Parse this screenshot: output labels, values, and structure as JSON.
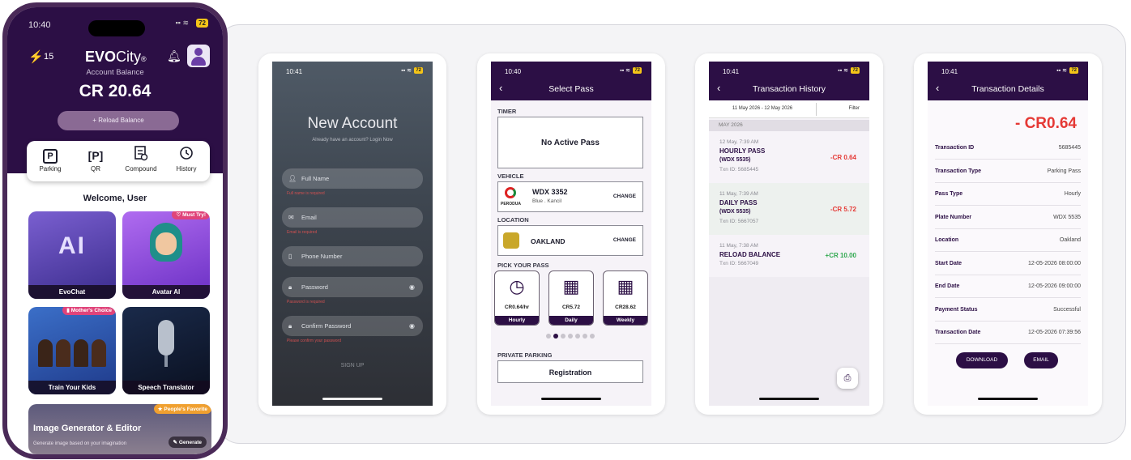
{
  "colors": {
    "brand": "#2c0f45",
    "negative": "#e53935",
    "positive": "#2fa84f",
    "battery": "#f5c518"
  },
  "home": {
    "time": "10:40",
    "battery": "72",
    "bolt_count": "15",
    "logo_bold": "EVO",
    "logo_rest": "City",
    "logo_mark": "®",
    "account_label": "Account Balance",
    "balance": "CR 20.64",
    "reload_label": "+ Reload Balance",
    "quick": [
      {
        "label": "Parking",
        "icon": "P"
      },
      {
        "label": "QR",
        "icon": "[P]"
      },
      {
        "label": "Compound",
        "icon": "compound-icon"
      },
      {
        "label": "History",
        "icon": "history-icon"
      }
    ],
    "welcome": "Welcome, User",
    "cards": [
      {
        "label": "EvoChat",
        "art": "AI"
      },
      {
        "label": "Avatar AI",
        "tag": "Must Try!"
      },
      {
        "label": "Train Your Kids",
        "tag": "Mother's Choice"
      },
      {
        "label": "Speech Translator"
      }
    ],
    "image_card": {
      "title": "Image Generator & Editor",
      "subtitle": "Generate image based on your imagination",
      "tag": "People's Favorite",
      "button": "Generate"
    }
  },
  "new_account": {
    "time": "10:41",
    "battery": "72",
    "title": "New Account",
    "subtitle": "Already have an account? Login Now",
    "fields": [
      {
        "placeholder": "Full Name",
        "error": "Full name is required"
      },
      {
        "placeholder": "Email",
        "error": "Email is required"
      },
      {
        "placeholder": "Phone Number",
        "error": ""
      },
      {
        "placeholder": "Password",
        "error": "Password is required"
      },
      {
        "placeholder": "Confirm Password",
        "error": "Please confirm your password"
      }
    ],
    "signup": "SIGN UP"
  },
  "select_pass": {
    "time": "10:40",
    "battery": "72",
    "title": "Select Pass",
    "timer_label": "TIMER",
    "no_active": "No Active Pass",
    "vehicle_label": "VEHICLE",
    "plate": "WDX 3352",
    "model": "Blue . Kancil",
    "brand": "PERODUA",
    "change": "CHANGE",
    "location_label": "LOCATION",
    "location": "OAKLAND",
    "pick_label": "PICK YOUR PASS",
    "passes": [
      {
        "price": "CR0.64/hr",
        "name": "Hourly"
      },
      {
        "price": "CR5.72",
        "name": "Daily"
      },
      {
        "price": "CR28.62",
        "name": "Weekly"
      }
    ],
    "pager_count": "7",
    "pager_active": "2",
    "private_label": "PRIVATE PARKING",
    "registration": "Registration"
  },
  "history": {
    "time": "10:41",
    "battery": "72",
    "title": "Transaction History",
    "date_range": "11 May 2026 - 12 May 2026",
    "filter": "Filter",
    "month": "MAY 2026",
    "items": [
      {
        "date": "12 May, 7:39 AM",
        "name": "HOURLY PASS",
        "plate": "(WDX 5535)",
        "txn": "Txn ID: 5685445",
        "amount": "-CR 0.64"
      },
      {
        "date": "11 May, 7:39 AM",
        "name": "DAILY PASS",
        "plate": "(WDX 5535)",
        "txn": "Txn ID: 5667057",
        "amount": "-CR 5.72"
      },
      {
        "date": "11 May, 7:38 AM",
        "name": "RELOAD BALANCE",
        "plate": "",
        "txn": "Txn ID: 5667049",
        "amount": "+CR 10.00"
      }
    ]
  },
  "details": {
    "time": "10:41",
    "battery": "72",
    "title": "Transaction Details",
    "amount": "- CR0.64",
    "rows": [
      {
        "key": "Transaction ID",
        "value": "5685445"
      },
      {
        "key": "Transaction Type",
        "value": "Parking Pass"
      },
      {
        "key": "Pass Type",
        "value": "Hourly"
      },
      {
        "key": "Plate Number",
        "value": "WDX 5535"
      },
      {
        "key": "Location",
        "value": "Oakland"
      },
      {
        "key": "Start Date",
        "value": "12-05-2026 08:00:00"
      },
      {
        "key": "End Date",
        "value": "12-05-2026 09:00:00"
      },
      {
        "key": "Payment Status",
        "value": "Successful"
      },
      {
        "key": "Transaction Date",
        "value": "12-05-2026 07:39:56"
      }
    ],
    "download": "DOWNLOAD",
    "email": "EMAIL"
  }
}
